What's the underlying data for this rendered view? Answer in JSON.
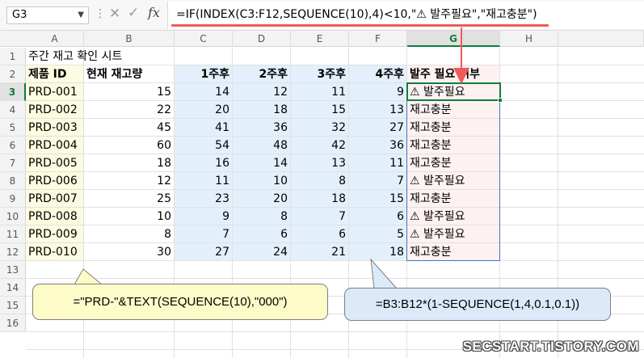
{
  "formula_bar": {
    "name_box": "G3",
    "formula": "=IF(INDEX(C3:F12,SEQUENCE(10),4)<10,\"⚠ 발주필요\",\"재고충분\")",
    "fx_label": "fx"
  },
  "columns": [
    "A",
    "B",
    "C",
    "D",
    "E",
    "F",
    "G",
    "H"
  ],
  "rows": [
    "1",
    "2",
    "3",
    "4",
    "5",
    "6",
    "7",
    "8",
    "9",
    "10",
    "11",
    "12",
    "13",
    "14",
    "15",
    "16"
  ],
  "sheet": {
    "title": "주간 재고 확인 시트",
    "headers": [
      "제품 ID",
      "현재 재고량",
      "1주후",
      "2주후",
      "3주후",
      "4주후",
      "발주 필요 여부"
    ],
    "data": [
      {
        "id": "PRD-001",
        "current": "15",
        "w1": "14",
        "w2": "12",
        "w3": "11",
        "w4": "9",
        "status": "⚠ 발주필요"
      },
      {
        "id": "PRD-002",
        "current": "22",
        "w1": "20",
        "w2": "18",
        "w3": "15",
        "w4": "13",
        "status": "재고충분"
      },
      {
        "id": "PRD-003",
        "current": "45",
        "w1": "41",
        "w2": "36",
        "w3": "32",
        "w4": "27",
        "status": "재고충분"
      },
      {
        "id": "PRD-004",
        "current": "60",
        "w1": "54",
        "w2": "48",
        "w3": "42",
        "w4": "36",
        "status": "재고충분"
      },
      {
        "id": "PRD-005",
        "current": "18",
        "w1": "16",
        "w2": "14",
        "w3": "13",
        "w4": "11",
        "status": "재고충분"
      },
      {
        "id": "PRD-006",
        "current": "12",
        "w1": "11",
        "w2": "10",
        "w3": "8",
        "w4": "7",
        "status": "⚠ 발주필요"
      },
      {
        "id": "PRD-007",
        "current": "25",
        "w1": "23",
        "w2": "20",
        "w3": "18",
        "w4": "15",
        "status": "재고충분"
      },
      {
        "id": "PRD-008",
        "current": "10",
        "w1": "9",
        "w2": "8",
        "w3": "7",
        "w4": "6",
        "status": "⚠ 발주필요"
      },
      {
        "id": "PRD-009",
        "current": "8",
        "w1": "7",
        "w2": "6",
        "w3": "6",
        "w4": "5",
        "status": "⚠ 발주필요"
      },
      {
        "id": "PRD-010",
        "current": "30",
        "w1": "27",
        "w2": "24",
        "w3": "21",
        "w4": "18",
        "status": "재고충분"
      }
    ]
  },
  "callouts": {
    "prd_formula": "=\"PRD-\"&TEXT(SEQUENCE(10),\"000\")",
    "qty_formula": "=B3:B12*(1-SEQUENCE(1,4,0.1,0.1))"
  },
  "watermark": "SECSTART.TISTORY.COM",
  "colors": {
    "id_fill": "#fdfbe0",
    "forecast_fill": "#e3f0fb",
    "status_fill": "#fdf1f1",
    "arrow": "#f05a5a",
    "active_border": "#107c41",
    "range_border": "#4472c4"
  }
}
